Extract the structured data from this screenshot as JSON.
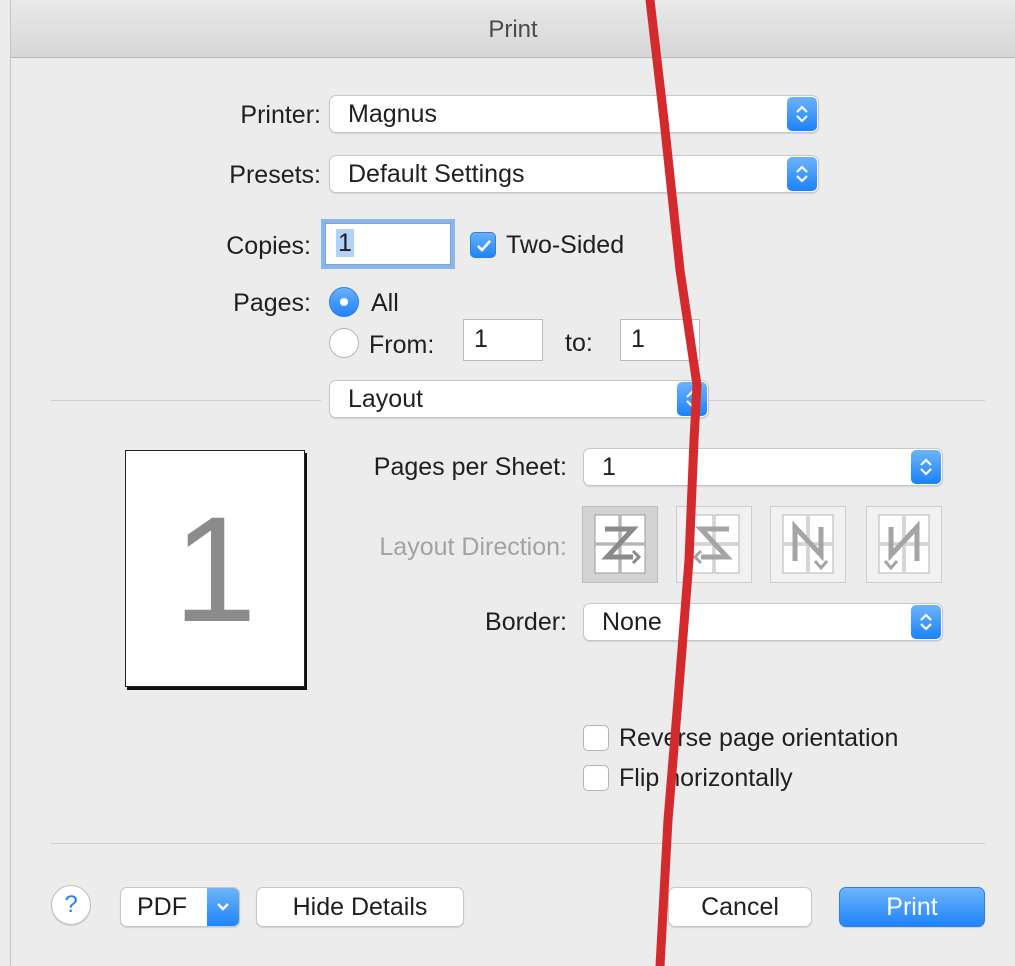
{
  "window": {
    "title": "Print"
  },
  "printer": {
    "label": "Printer:",
    "value": "Magnus"
  },
  "presets": {
    "label": "Presets:",
    "value": "Default Settings"
  },
  "copies": {
    "label": "Copies:",
    "value": "1",
    "two_sided_label": "Two-Sided",
    "two_sided_checked": true
  },
  "pages": {
    "label": "Pages:",
    "all_label": "All",
    "from_label": "From:",
    "from_value": "1",
    "to_label": "to:",
    "to_value": "1",
    "selected": "All"
  },
  "section": {
    "value": "Layout"
  },
  "preview": {
    "page_number": "1"
  },
  "layout": {
    "pages_per_sheet_label": "Pages per Sheet:",
    "pages_per_sheet_value": "1",
    "direction_label": "Layout Direction:",
    "directions": [
      "z-left-to-right",
      "reverse-z",
      "n-top-to-bottom",
      "reverse-n"
    ],
    "selected_direction": 0,
    "border_label": "Border:",
    "border_value": "None",
    "reverse_orientation_label": "Reverse page orientation",
    "flip_horizontally_label": "Flip horizontally"
  },
  "buttons": {
    "help": "?",
    "pdf": "PDF",
    "hide_details": "Hide Details",
    "cancel": "Cancel",
    "print": "Print"
  },
  "colors": {
    "accent": "#1e84fb",
    "annotation": "#d42a2e"
  },
  "icons": {
    "stepper": "up-down-chevrons-icon",
    "check": "checkmark-icon",
    "pdf_menu": "chevron-down-icon"
  }
}
